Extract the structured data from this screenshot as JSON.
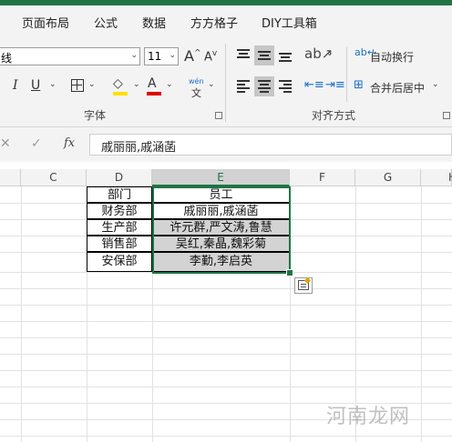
{
  "tabs": [
    "页面布局",
    "公式",
    "数据",
    "方方格子",
    "DIY工具箱"
  ],
  "font_group": {
    "font_name": "线",
    "font_size": "11",
    "grow_label": "A",
    "shrink_label": "A",
    "italic_label": "I",
    "underline_label": "U",
    "font_color_label": "A",
    "phonetic_top": "wén",
    "phonetic_bottom": "文",
    "highlight_color": "#ffe000",
    "font_color": "#e00000",
    "group_label": "字体"
  },
  "align_group": {
    "wrap_label": "自动换行",
    "merge_label": "合并后居中",
    "group_label": "对齐方式"
  },
  "formula_bar": {
    "fx_label": "fx",
    "content": "戚丽丽,戚涵菡"
  },
  "columns": [
    "C",
    "D",
    "E",
    "F",
    "G",
    "H"
  ],
  "selected_column": "E",
  "table": {
    "header": [
      "部门",
      "员工"
    ],
    "rows": [
      [
        "财务部",
        "戚丽丽,戚涵菡"
      ],
      [
        "生产部",
        "许元群,严文涛,鲁慧"
      ],
      [
        "销售部",
        "吴红,秦晶,魏彩菊"
      ],
      [
        "安保部",
        "李勤,李启英"
      ]
    ]
  },
  "watermark": "河南龙网",
  "colors": {
    "accent": "#217346",
    "selected_cell_fill": "#d3d3d3"
  }
}
